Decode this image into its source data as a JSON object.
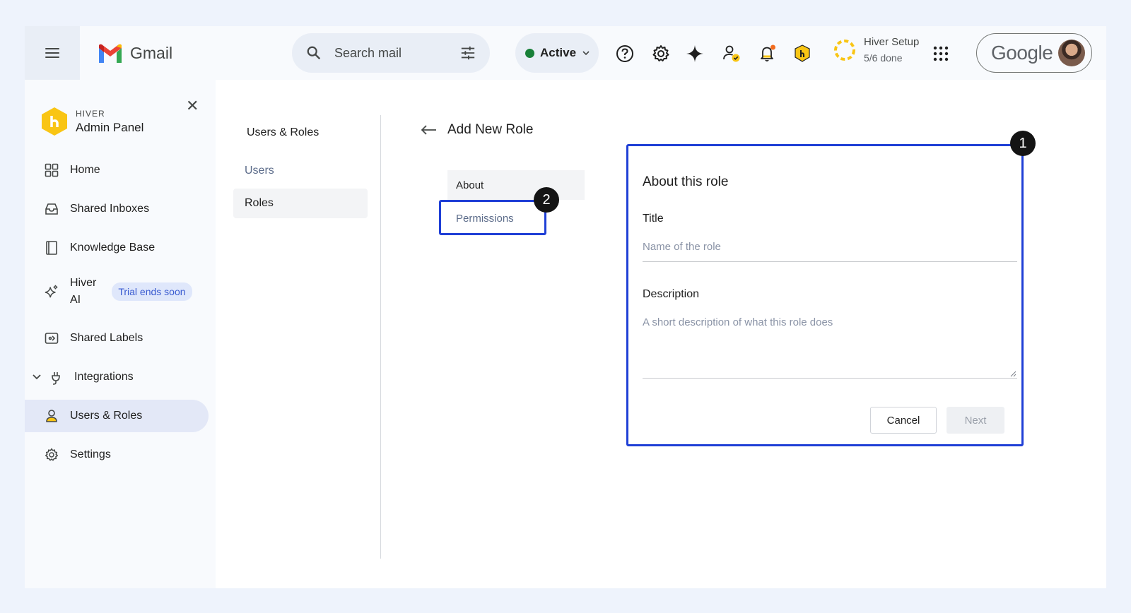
{
  "header": {
    "app_name": "Gmail",
    "search_placeholder": "Search mail",
    "status_label": "Active",
    "setup_title": "Hiver Setup",
    "setup_progress": "5/6 done",
    "google_label": "Google",
    "colors": {
      "active_dot": "#188038",
      "notification_dot": "#f26b1d",
      "hiver_yellow": "#f9c514"
    }
  },
  "sidebar": {
    "brand_small": "HIVER",
    "brand_big": "Admin Panel",
    "items": [
      {
        "label": "Home",
        "icon": "home-grid-icon"
      },
      {
        "label": "Shared Inboxes",
        "icon": "inbox-icon"
      },
      {
        "label": "Knowledge Base",
        "icon": "book-icon"
      },
      {
        "label": "Hiver\nAI",
        "icon": "sparkle-icon",
        "badge": "Trial ends soon"
      },
      {
        "label": "Shared Labels",
        "icon": "label-icon"
      },
      {
        "label": "Integrations",
        "icon": "plug-icon"
      },
      {
        "label": "Users & Roles",
        "icon": "user-icon",
        "active": true
      },
      {
        "label": "Settings",
        "icon": "gear-icon"
      }
    ]
  },
  "subnav": {
    "title": "Users & Roles",
    "items": [
      "Users",
      "Roles"
    ]
  },
  "page": {
    "title": "Add New Role",
    "steps": [
      "About",
      "Permissions"
    ]
  },
  "card": {
    "title": "About this role",
    "title_label": "Title",
    "title_placeholder": "Name of the role",
    "description_label": "Description",
    "description_placeholder": "A short description of what this role does",
    "cancel_label": "Cancel",
    "next_label": "Next"
  },
  "annotations": [
    "1",
    "2"
  ]
}
